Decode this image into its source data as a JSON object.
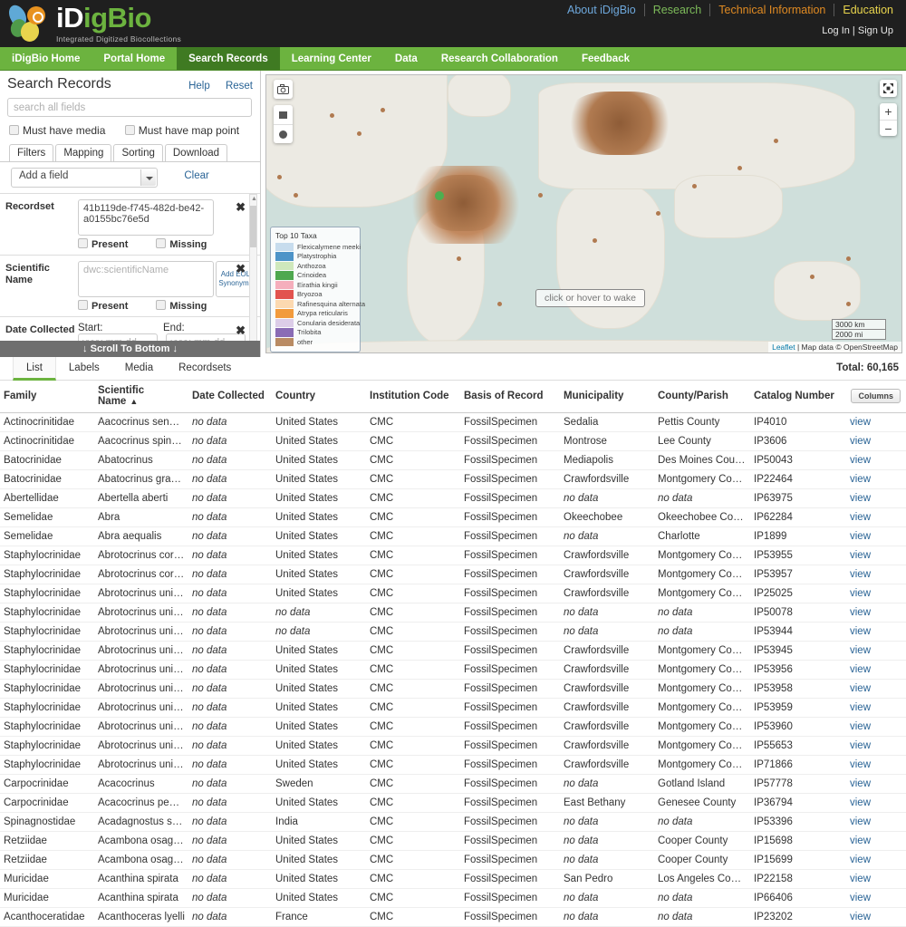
{
  "brand": {
    "name_white": "iD",
    "name_green": "igBio",
    "tagline": "Integrated Digitized Biocollections"
  },
  "top_nav": [
    {
      "label": "About iDigBio",
      "color": "#6ea8dc"
    },
    {
      "label": "Research",
      "color": "#7dbb5a"
    },
    {
      "label": "Technical Information",
      "color": "#e08a22"
    },
    {
      "label": "Education",
      "color": "#e8d44d"
    }
  ],
  "account": {
    "login": "Log In",
    "sep": " | ",
    "signup": "Sign Up"
  },
  "green_nav": [
    {
      "label": "iDigBio Home",
      "active": false
    },
    {
      "label": "Portal Home",
      "active": false
    },
    {
      "label": "Search Records",
      "active": true
    },
    {
      "label": "Learning Center",
      "active": false
    },
    {
      "label": "Data",
      "active": false
    },
    {
      "label": "Research Collaboration",
      "active": false
    },
    {
      "label": "Feedback",
      "active": false
    }
  ],
  "sidebar": {
    "title": "Search Records",
    "help": "Help",
    "reset": "Reset",
    "search_placeholder": "search all fields",
    "search_value": "",
    "check_media": "Must have media",
    "check_mappoint": "Must have map point",
    "tabs": [
      "Filters",
      "Mapping",
      "Sorting",
      "Download"
    ],
    "active_tab": "Filters",
    "add_field": "Add a field",
    "clear": "Clear",
    "present": "Present",
    "missing": "Missing",
    "filters": [
      {
        "label": "Recordset",
        "value": "41b119de-f745-482d-be42-a0155bc76e5d",
        "placeholder": ""
      },
      {
        "label": "Scientific Name",
        "value": "",
        "placeholder": "dwc:scientificName",
        "eol_button": "Add EOL Synonyms"
      }
    ],
    "date_filter": {
      "label": "Date Collected",
      "start_label": "Start:",
      "end_label": "End:",
      "start_placeholder": "yyyy-mm-dd",
      "end_placeholder": "yyyy-mm-dd",
      "start_value": "",
      "end_value": ""
    },
    "scroll_to_bottom": "↓ Scroll To Bottom ↓"
  },
  "map": {
    "wake_text": "click or hover to wake",
    "legend_title": "Top 10 Taxa",
    "legend": [
      {
        "name": "Flexicalymene meeki",
        "color": "#c7dced"
      },
      {
        "name": "Platystrophia",
        "color": "#4e94c8"
      },
      {
        "name": "Anthozoa",
        "color": "#cfe8bc"
      },
      {
        "name": "Crinoidea",
        "color": "#4fa84f"
      },
      {
        "name": "Eirathia kingii",
        "color": "#f5aebc"
      },
      {
        "name": "Bryozoa",
        "color": "#e2534f"
      },
      {
        "name": "Rafinesquina alternata",
        "color": "#fcd9b0"
      },
      {
        "name": "Atrypa reticularis",
        "color": "#f29b3d"
      },
      {
        "name": "Conularia desiderata",
        "color": "#dccde8"
      },
      {
        "name": "Trilobita",
        "color": "#8a6cb5"
      },
      {
        "name": "other",
        "color": "#b98b63"
      }
    ],
    "scale_km": "3000 km",
    "scale_mi": "2000 mi",
    "attribution_leaflet": "Leaflet",
    "attribution_rest": " | Map data © OpenStreetMap",
    "tools": {
      "camera": "camera-icon",
      "rectangle": "rectangle-draw-icon",
      "circle": "circle-draw-icon",
      "fullscreen": "fullscreen-icon",
      "zoom_in": "+",
      "zoom_out": "−"
    }
  },
  "results": {
    "tabs": [
      "List",
      "Labels",
      "Media",
      "Recordsets"
    ],
    "active_tab": "List",
    "total_label": "Total: 60,165",
    "columns_button": "Columns",
    "view_label": "view",
    "no_data": "no data",
    "sort_indicator": "▲",
    "headers": [
      "Family",
      "Scientific Name",
      "Date Collected",
      "Country",
      "Institution Code",
      "Basis of Record",
      "Municipality",
      "County/Parish",
      "Catalog Number"
    ],
    "sorted_column": "Scientific Name",
    "rows": [
      [
        "Actinocrinitidae",
        "Aacocrinus senectus",
        "",
        "United States",
        "CMC",
        "FossilSpecimen",
        "Sedalia",
        "Pettis County",
        "IP4010"
      ],
      [
        "Actinocrinitidae",
        "Aacocrinus spinulosus",
        "",
        "United States",
        "CMC",
        "FossilSpecimen",
        "Montrose",
        "Lee County",
        "IP3606"
      ],
      [
        "Batocrinidae",
        "Abatocrinus",
        "",
        "United States",
        "CMC",
        "FossilSpecimen",
        "Mediapolis",
        "Des Moines County",
        "IP50043"
      ],
      [
        "Batocrinidae",
        "Abatocrinus grandis",
        "",
        "United States",
        "CMC",
        "FossilSpecimen",
        "Crawfordsville",
        "Montgomery County",
        "IP22464"
      ],
      [
        "Abertellidae",
        "Abertella aberti",
        "",
        "United States",
        "CMC",
        "FossilSpecimen",
        "",
        "",
        "IP63975"
      ],
      [
        "Semelidae",
        "Abra",
        "",
        "United States",
        "CMC",
        "FossilSpecimen",
        "Okeechobee",
        "Okeechobee County",
        "IP62284"
      ],
      [
        "Semelidae",
        "Abra aequalis",
        "",
        "United States",
        "CMC",
        "FossilSpecimen",
        "",
        "Charlotte",
        "IP1899"
      ],
      [
        "Staphylocrinidae",
        "Abrotocrinus coreyi",
        "",
        "United States",
        "CMC",
        "FossilSpecimen",
        "Crawfordsville",
        "Montgomery County",
        "IP53955"
      ],
      [
        "Staphylocrinidae",
        "Abrotocrinus coreyi",
        "",
        "United States",
        "CMC",
        "FossilSpecimen",
        "Crawfordsville",
        "Montgomery County",
        "IP53957"
      ],
      [
        "Staphylocrinidae",
        "Abrotocrinus unicus",
        "",
        "United States",
        "CMC",
        "FossilSpecimen",
        "Crawfordsville",
        "Montgomery County",
        "IP25025"
      ],
      [
        "Staphylocrinidae",
        "Abrotocrinus unicus",
        "",
        "",
        "CMC",
        "FossilSpecimen",
        "",
        "",
        "IP50078"
      ],
      [
        "Staphylocrinidae",
        "Abrotocrinus unicus",
        "",
        "",
        "CMC",
        "FossilSpecimen",
        "",
        "",
        "IP53944"
      ],
      [
        "Staphylocrinidae",
        "Abrotocrinus unicus",
        "",
        "United States",
        "CMC",
        "FossilSpecimen",
        "Crawfordsville",
        "Montgomery County",
        "IP53945"
      ],
      [
        "Staphylocrinidae",
        "Abrotocrinus unicus",
        "",
        "United States",
        "CMC",
        "FossilSpecimen",
        "Crawfordsville",
        "Montgomery County",
        "IP53956"
      ],
      [
        "Staphylocrinidae",
        "Abrotocrinus unicus",
        "",
        "United States",
        "CMC",
        "FossilSpecimen",
        "Crawfordsville",
        "Montgomery County",
        "IP53958"
      ],
      [
        "Staphylocrinidae",
        "Abrotocrinus unicus",
        "",
        "United States",
        "CMC",
        "FossilSpecimen",
        "Crawfordsville",
        "Montgomery County",
        "IP53959"
      ],
      [
        "Staphylocrinidae",
        "Abrotocrinus unicus",
        "",
        "United States",
        "CMC",
        "FossilSpecimen",
        "Crawfordsville",
        "Montgomery County",
        "IP53960"
      ],
      [
        "Staphylocrinidae",
        "Abrotocrinus unicus",
        "",
        "United States",
        "CMC",
        "FossilSpecimen",
        "Crawfordsville",
        "Montgomery County",
        "IP55653"
      ],
      [
        "Staphylocrinidae",
        "Abrotocrinus unicus",
        "",
        "United States",
        "CMC",
        "FossilSpecimen",
        "Crawfordsville",
        "Montgomery County",
        "IP71866"
      ],
      [
        "Carpocrinidae",
        "Acacocrinus",
        "",
        "Sweden",
        "CMC",
        "FossilSpecimen",
        "",
        "Gotland Island",
        "IP57778"
      ],
      [
        "Carpocrinidae",
        "Acacocrinus pentadac...",
        "",
        "United States",
        "CMC",
        "FossilSpecimen",
        "East Bethany",
        "Genesee County",
        "IP36794"
      ],
      [
        "Spinagnostidae",
        "Acadagnostus scutalis",
        "",
        "India",
        "CMC",
        "FossilSpecimen",
        "",
        "",
        "IP53396"
      ],
      [
        "Retziidae",
        "Acambona osagensis",
        "",
        "United States",
        "CMC",
        "FossilSpecimen",
        "",
        "Cooper County",
        "IP15698"
      ],
      [
        "Retziidae",
        "Acambona osagensis",
        "",
        "United States",
        "CMC",
        "FossilSpecimen",
        "",
        "Cooper County",
        "IP15699"
      ],
      [
        "Muricidae",
        "Acanthina spirata",
        "",
        "United States",
        "CMC",
        "FossilSpecimen",
        "San Pedro",
        "Los Angeles County",
        "IP22158"
      ],
      [
        "Muricidae",
        "Acanthina spirata",
        "",
        "United States",
        "CMC",
        "FossilSpecimen",
        "",
        "",
        "IP66406"
      ],
      [
        "Acanthoceratidae",
        "Acanthoceras lyelli",
        "",
        "France",
        "CMC",
        "FossilSpecimen",
        "",
        "",
        "IP23202"
      ]
    ]
  }
}
